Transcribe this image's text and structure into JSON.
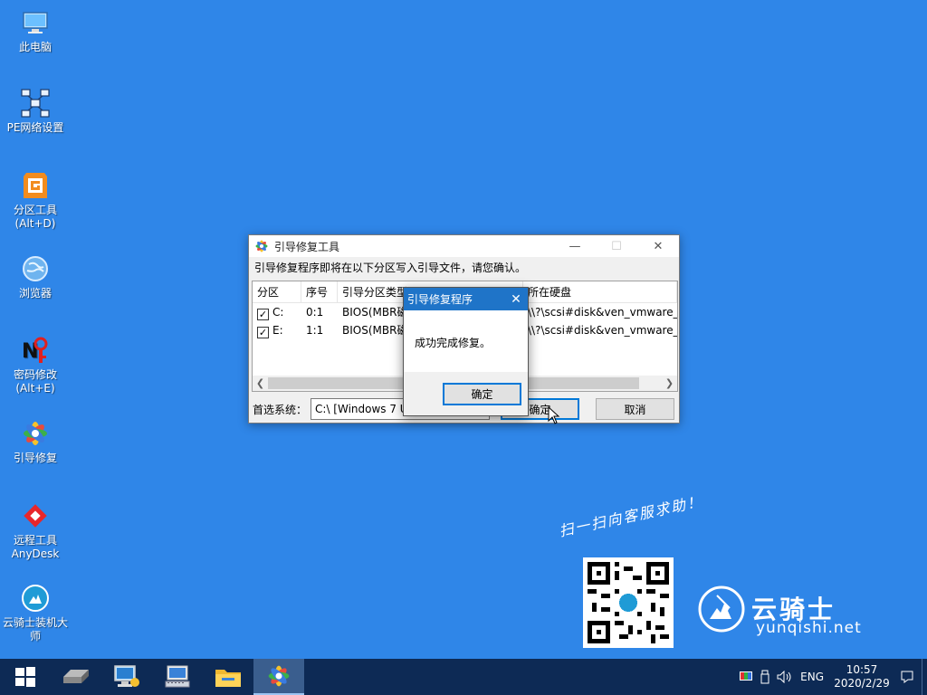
{
  "desktop": {
    "icons": [
      {
        "lines": [
          "此电脑"
        ],
        "icon": "computer-icon"
      },
      {
        "lines": [
          "PE网络设置"
        ],
        "icon": "network-icon"
      },
      {
        "lines": [
          "分区工具",
          "(Alt+D)"
        ],
        "icon": "partition-tool-icon"
      },
      {
        "lines": [
          "浏览器"
        ],
        "icon": "browser-icon"
      },
      {
        "lines": [
          "密码修改",
          "(Alt+E)"
        ],
        "icon": "password-icon"
      },
      {
        "lines": [
          "引导修复"
        ],
        "icon": "boot-repair-icon"
      },
      {
        "lines": [
          "远程工具",
          "AnyDesk"
        ],
        "icon": "anydesk-icon"
      },
      {
        "lines": [
          "云骑士装机大",
          "师"
        ],
        "icon": "yunqishi-icon"
      }
    ]
  },
  "main_window": {
    "title": "引导修复工具",
    "description": "引导修复程序即将在以下分区写入引导文件，请您确认。",
    "columns": [
      "分区",
      "序号",
      "引导分区类型",
      "所在硬盘"
    ],
    "rows": [
      {
        "partition": "C:",
        "index": "0:1",
        "type": "BIOS(MBR磁",
        "disk": "\\\\?\\scsi#disk&ven_vmware_&",
        "checked": true
      },
      {
        "partition": "E:",
        "index": "1:1",
        "type": "BIOS(MBR磁",
        "disk": "\\\\?\\scsi#disk&ven_vmware_&",
        "checked": true
      }
    ],
    "preferred_label": "首选系统：",
    "preferred_value": "C:\\ [Windows 7 U",
    "ok_label": "确定",
    "cancel_label": "取消"
  },
  "dialog": {
    "title": "引导修复程序",
    "message": "成功完成修复。",
    "ok_label": "确定"
  },
  "branding": {
    "scan_text": "扫一扫向客服求助！",
    "name": "云骑士",
    "url": "yunqishi.net"
  },
  "taskbar": {
    "language": "ENG",
    "time": "10:57",
    "date": "2020/2/29"
  }
}
